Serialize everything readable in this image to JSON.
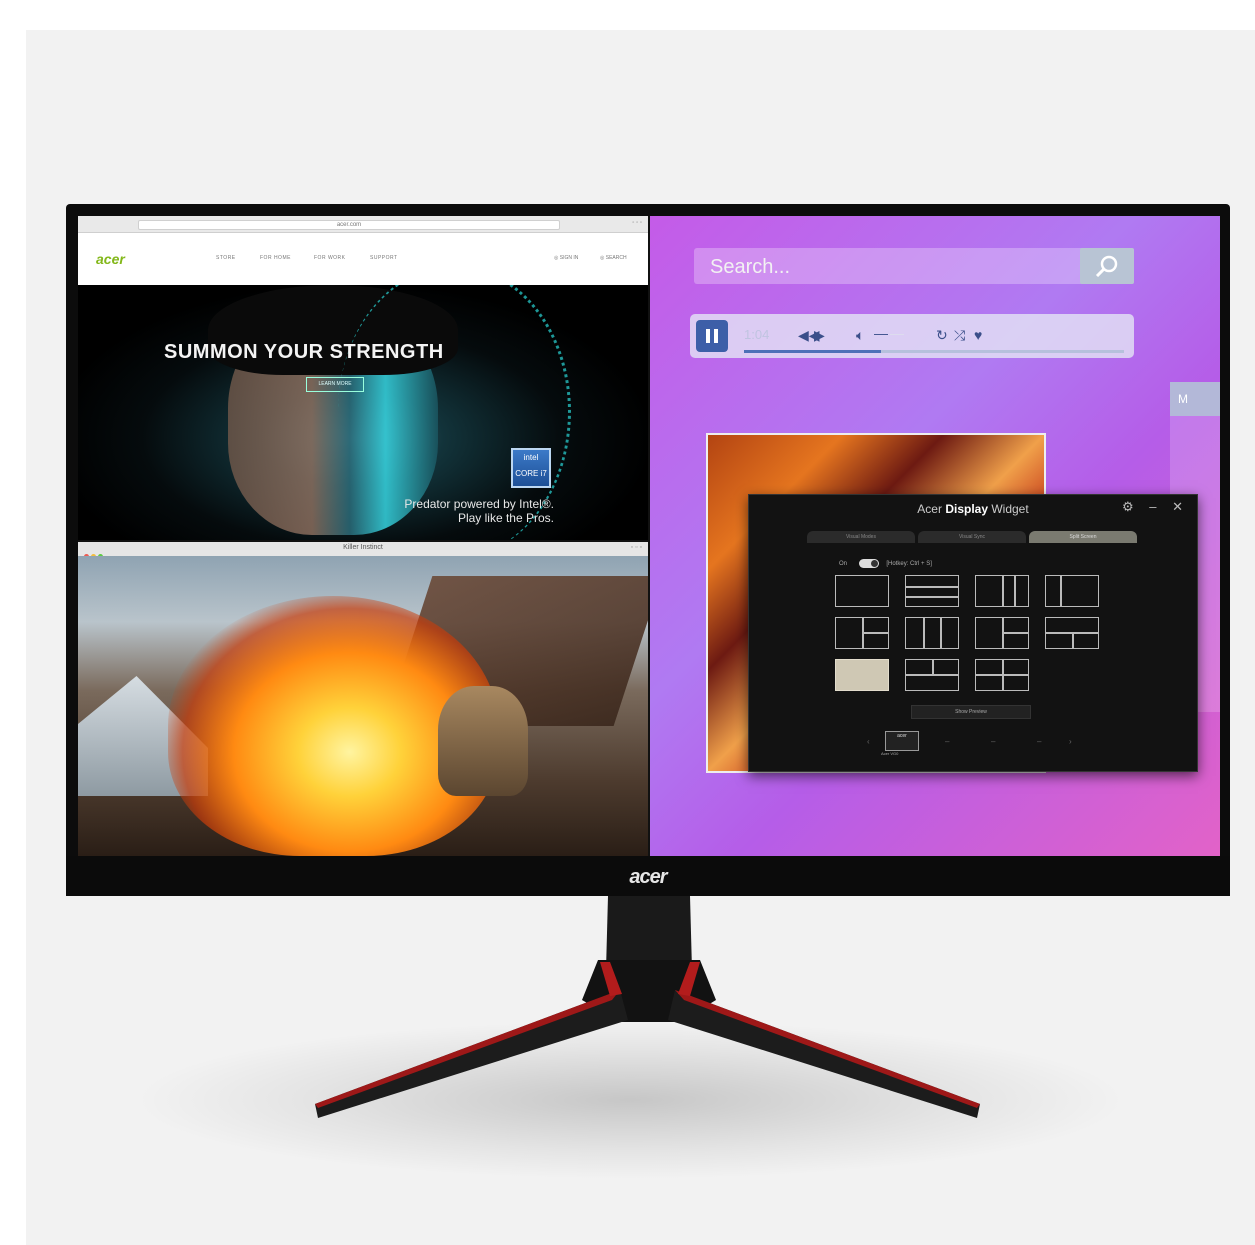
{
  "browser": {
    "url": "acer.com",
    "site_logo": "acer",
    "nav": [
      "STORE",
      "FOR HOME",
      "FOR WORK",
      "SUPPORT"
    ],
    "nav_right": [
      "◎ SIGN IN",
      "◎ SEARCH"
    ],
    "hero_title": "SUMMON YOUR STRENGTH",
    "hero_button": "LEARN MORE",
    "hero_caption": "Predator powered by Intel®.\nPlay like the Pros.",
    "intel_badge": "intel CORE i7"
  },
  "game_window": {
    "title": "Killer Instinct",
    "dot_colors": [
      "#ee5b52",
      "#f3bd3e",
      "#5fcb45"
    ]
  },
  "desktop": {
    "search": {
      "placeholder": "Search..."
    },
    "player": {
      "time": "1:04",
      "progress": 0.36
    },
    "side_tab": "M"
  },
  "widget": {
    "title_prefix": "Acer",
    "title_bold": "Display",
    "title_suffix": "Widget",
    "controls": "⚙ – ✕",
    "tabs": [
      {
        "label": "Visual Modes",
        "active": false
      },
      {
        "label": "Visual Sync",
        "active": false
      },
      {
        "label": "Split Screen",
        "active": true
      }
    ],
    "toggle_label": "On",
    "hotkey_label": "[Hotkey: Ctrl + S]",
    "show_preview": "Show Preview",
    "monitor_label": "acer",
    "monitor_name": "Acer VG0"
  },
  "bezel_logo": "acer",
  "accent_colors": {
    "acer_green": "#83b81a",
    "stand_red": "#a31a1a",
    "player_blue": "#3d5fa8"
  }
}
